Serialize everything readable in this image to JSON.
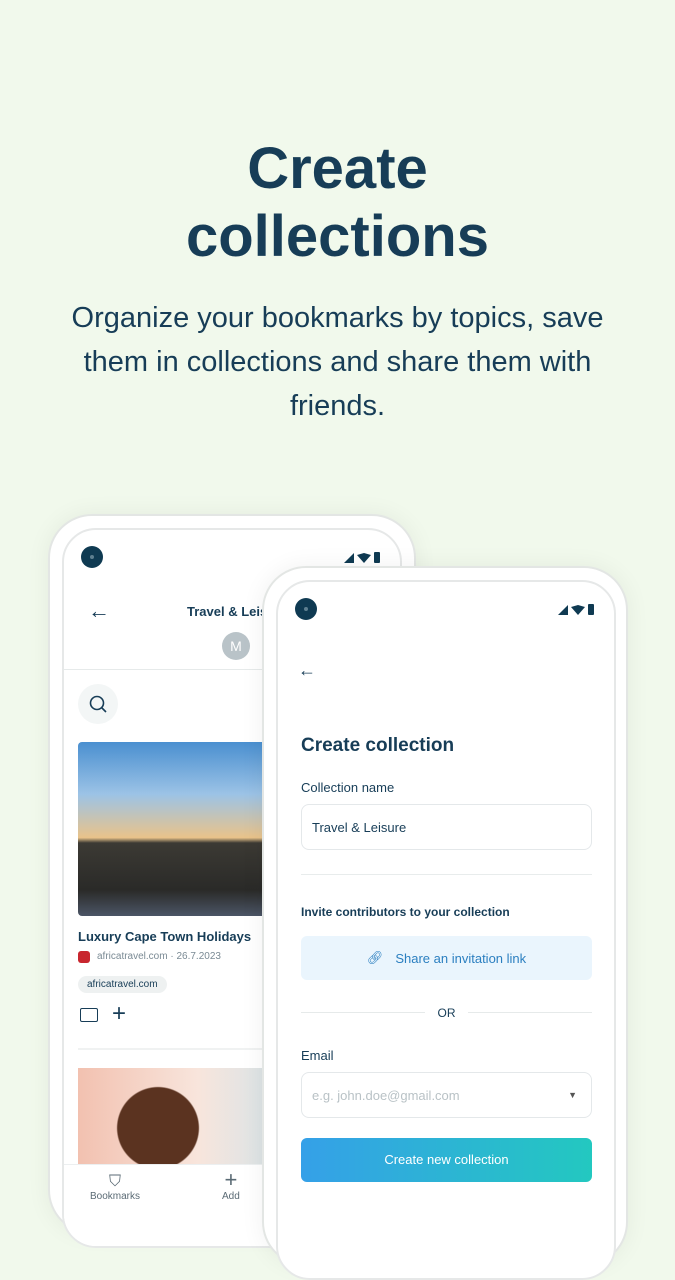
{
  "hero": {
    "title_line1": "Create",
    "title_line2": "collections",
    "subtitle": "Organize your bookmarks by topics, save them in collections and share them with friends."
  },
  "phone_back": {
    "title": "Travel & Leisure",
    "avatar": "M",
    "card": {
      "title": "Luxury Cape Town Holidays",
      "source": "africatravel.com · 26.7.2023",
      "tag": "africatravel.com"
    },
    "nav": [
      {
        "label": "Bookmarks",
        "icon": "bookmark-icon"
      },
      {
        "label": "Add",
        "icon": "plus-icon"
      }
    ]
  },
  "phone_front": {
    "heading": "Create collection",
    "name_label": "Collection name",
    "name_value": "Travel & Leisure",
    "invite_label": "Invite contributors to your collection",
    "share_label": "Share an invitation link",
    "or": "OR",
    "email_label": "Email",
    "email_placeholder": "e.g. john.doe@gmail.com",
    "create_label": "Create new collection"
  },
  "colors": {
    "background": "#f1f9ec",
    "primary": "#173d57",
    "button_start": "#35a0e8",
    "button_end": "#23c8c0"
  }
}
